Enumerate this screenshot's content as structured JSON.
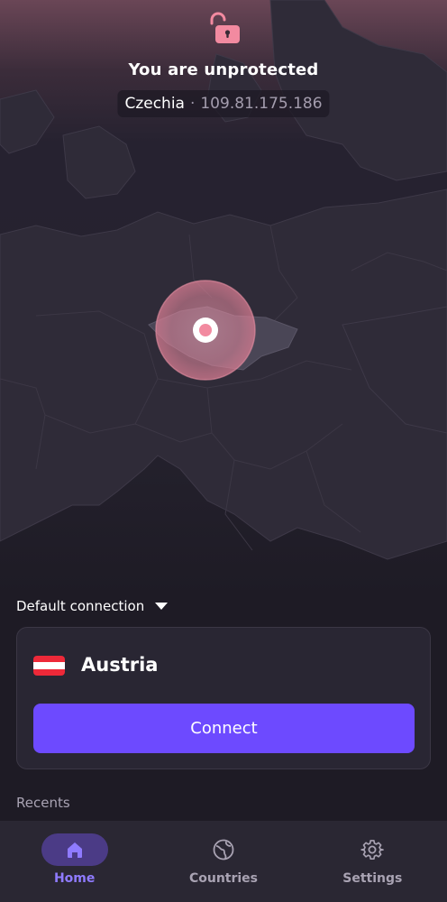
{
  "status": {
    "title": "You are unprotected",
    "country": "Czechia",
    "separator": "·",
    "ip": "109.81.175.186",
    "lock_icon": "unlocked-padlock-icon",
    "accent_color": "#f28aa0"
  },
  "default_connection": {
    "label": "Default connection",
    "dropdown_icon": "caret-down-icon",
    "country": "Austria",
    "flag_colors": [
      "#ed2939",
      "#ffffff",
      "#ed2939"
    ],
    "connect_label": "Connect",
    "button_color": "#6d4aff"
  },
  "recents": {
    "label": "Recents"
  },
  "nav": {
    "items": [
      {
        "label": "Home",
        "icon": "home-icon",
        "active": true
      },
      {
        "label": "Countries",
        "icon": "globe-icon",
        "active": false
      },
      {
        "label": "Settings",
        "icon": "gear-icon",
        "active": false
      }
    ]
  }
}
